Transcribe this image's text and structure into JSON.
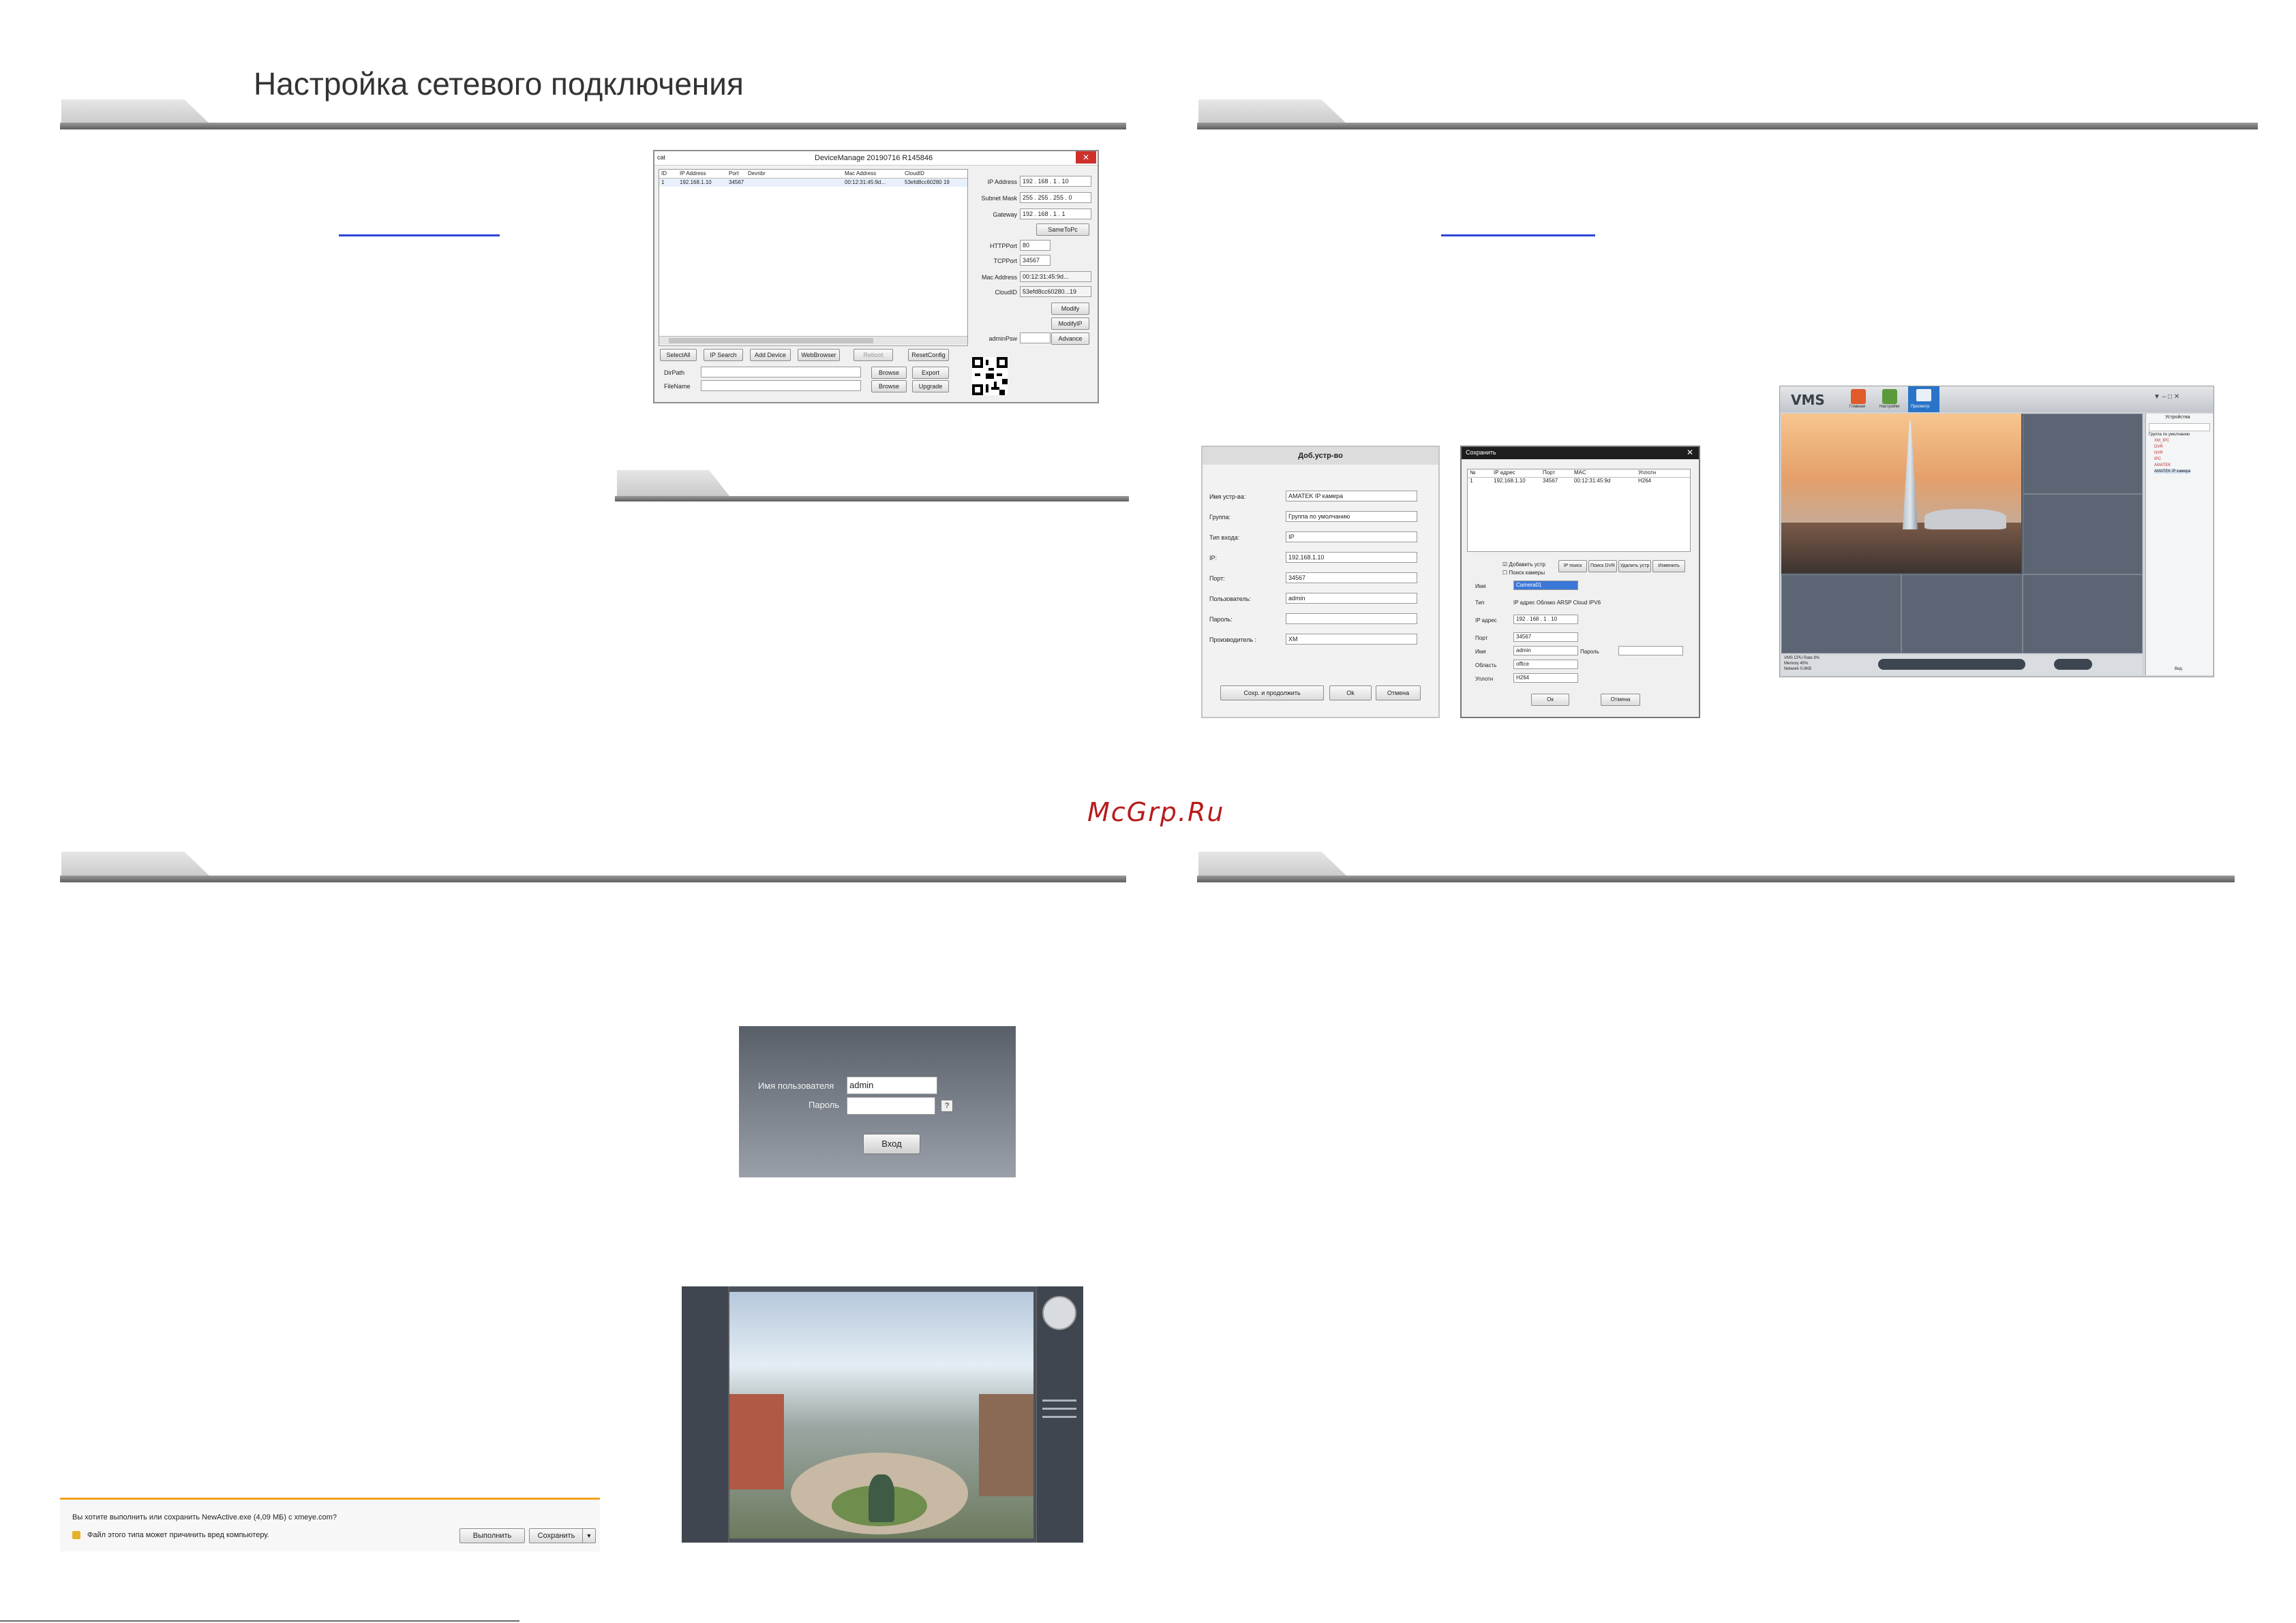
{
  "page": {
    "title": "Настройка сетевого подключения",
    "watermark": "McGrp.Ru"
  },
  "device_manager": {
    "corner": "cat",
    "title": "DeviceManage 20190716 R145846",
    "columns": [
      "ID",
      "IP Address",
      "Port",
      "Devnbr",
      "Mac Address",
      "CloudID"
    ],
    "row": [
      "1",
      "192.168.1.10",
      "34567",
      "",
      "00:12:31:45:9d...",
      "53efd8cc60280 19"
    ],
    "fields": [
      {
        "label": "IP Address",
        "value": "192 . 168 . 1 . 10"
      },
      {
        "label": "Subnet Mask",
        "value": "255 . 255 . 255 . 0"
      },
      {
        "label": "Gateway",
        "value": "192 . 168 . 1 . 1"
      },
      {
        "label": "HTTPPort",
        "value": "80"
      },
      {
        "label": "TCPPort",
        "value": "34567"
      },
      {
        "label": "Mac Address",
        "value": "00:12:31:45:9d..."
      },
      {
        "label": "CloudID",
        "value": "53efd8cc60280...19"
      },
      {
        "label": "adminPsw",
        "value": ""
      }
    ],
    "same_to_pc": "SameToPc",
    "modify": "Modify",
    "modify_ip": "ModifyIP",
    "advance": "Advance",
    "buttons": [
      "SelectAll",
      "IP Search",
      "Add Device",
      "WebBrowser",
      "Reboot",
      "ResetConfig"
    ],
    "dir_path": "DirPath",
    "file_name": "FileName",
    "browse": "Browse",
    "export": "Export",
    "upgrade": "Upgrade"
  },
  "add_device": {
    "title": "Доб.устр-во",
    "fields": [
      {
        "label": "Имя устр-ва:",
        "value": "AMATEK IP камера"
      },
      {
        "label": "Группа:",
        "value": "Группа по умолчанию"
      },
      {
        "label": "Тип входа:",
        "value": "IP"
      },
      {
        "label": "IP:",
        "value": "192.168.1.10"
      },
      {
        "label": "Порт:",
        "value": "34567"
      },
      {
        "label": "Пользователь:",
        "value": "admin"
      },
      {
        "label": "Пароль:",
        "value": ""
      },
      {
        "label": "Производитель :",
        "value": "XM"
      }
    ],
    "buttons": [
      "Сохр. и продолжить",
      "Ok",
      "Отмена"
    ]
  },
  "save_dialog": {
    "title": "Сохранить",
    "columns": [
      "№",
      "IP адрес",
      "Порт",
      "MAC",
      "Уплотн"
    ],
    "row": [
      "1",
      "192.168.1.10",
      "34567",
      "00:12:31:45:9d",
      "H264"
    ],
    "check1": "Добавить устр",
    "check2": "Поиск камеры",
    "tool_buttons": [
      "IP поиск",
      "Поиск DVR",
      "Удалить устр",
      "Изменить"
    ],
    "fields": [
      {
        "label": "Имя",
        "value": "Camera01"
      },
      {
        "label": "Тип",
        "value": "IP адрес   Облако   ARSP   Cloud   IPV6"
      },
      {
        "label": "IP адрес",
        "value": "192 . 168 . 1 . 10"
      },
      {
        "label": "Порт",
        "value": "34567"
      },
      {
        "label": "Имя",
        "value": "admin"
      },
      {
        "label": "Область",
        "value": "office"
      },
      {
        "label": "Уплотн",
        "value": "H264"
      }
    ],
    "password_label": "Пароль",
    "ok": "Ок",
    "cancel": "Отмена"
  },
  "vms": {
    "logo": "VMS",
    "tabs": [
      "Главная",
      "Настройки",
      "Просмотр"
    ],
    "tree": [
      "Группа по умолчанию",
      "XM_IPC",
      "DVR",
      "NVR",
      "IPC",
      "AMATEK",
      "AMATEK IP камера"
    ],
    "panel_title": "Устройства",
    "bottom_label": "Вид",
    "status": [
      "VMS CPU Rate 9%",
      "Memory 45%",
      "Network 0.0KB"
    ]
  },
  "login": {
    "user_label": "Имя пользователя",
    "user_value": "admin",
    "password_label": "Пароль",
    "help": "?",
    "button": "Вход"
  },
  "download_bar": {
    "question": "Вы хотите выполнить или сохранить NewActive.exe (4,09 МБ) с xmeye.com?",
    "warning": "Файл этого типа может причинить вред компьютеру.",
    "run": "Выполнить",
    "save": "Сохранить"
  }
}
